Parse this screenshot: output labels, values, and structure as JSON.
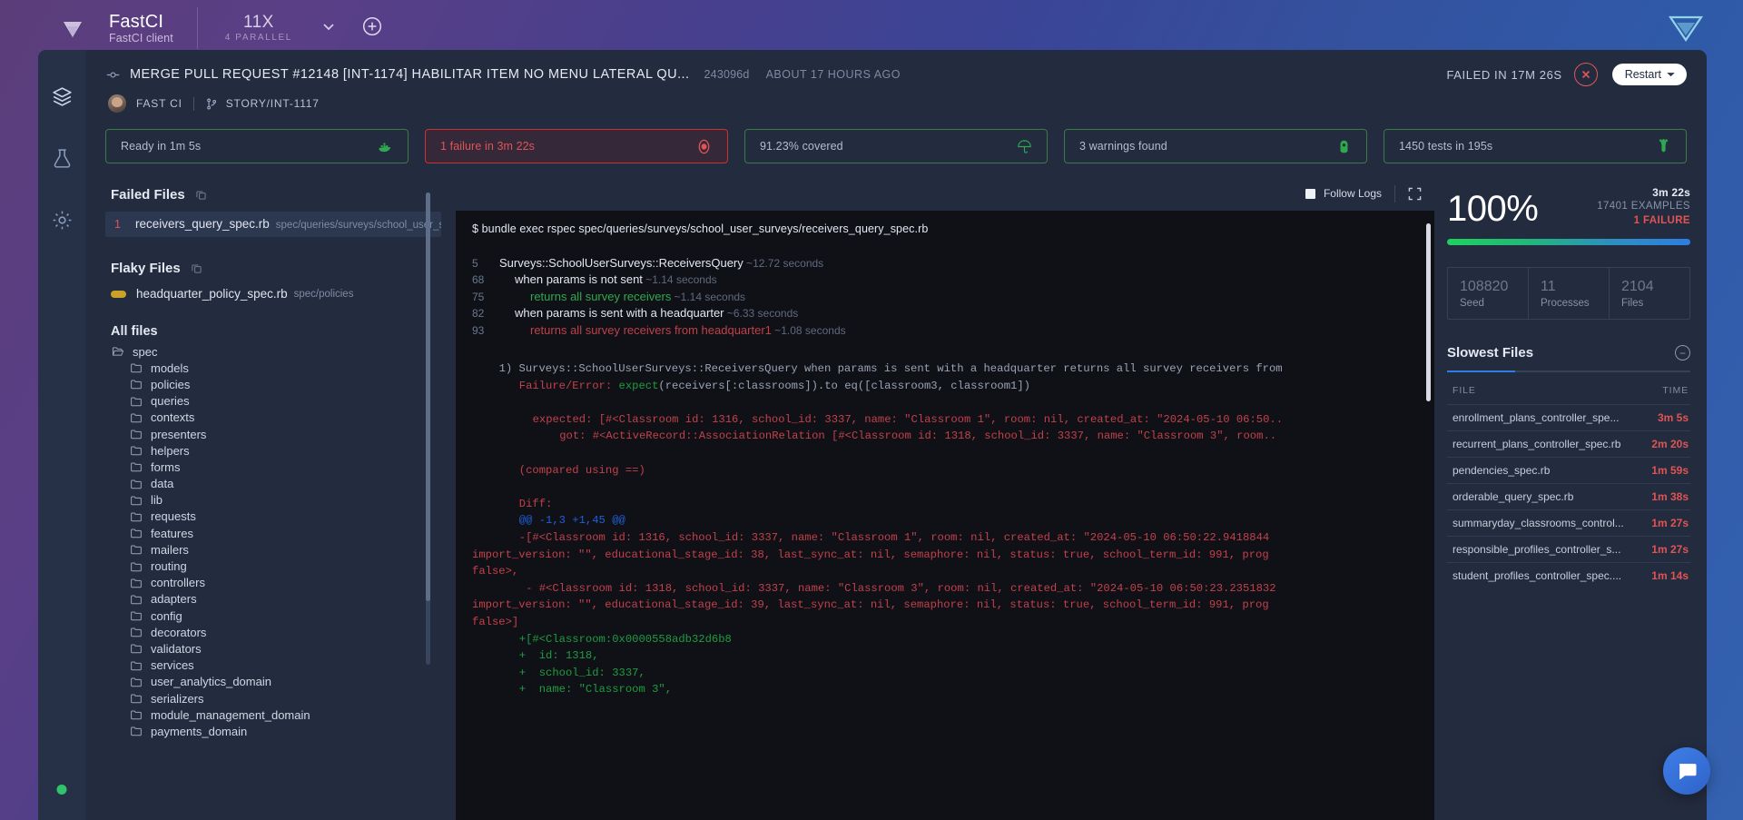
{
  "topbar": {
    "logo_icon": "fastci-diamond-logo",
    "brand_name": "FastCI",
    "brand_sub": "FastCI client",
    "parallel_value": "11X",
    "parallel_label": "4 PARALLEL",
    "chevron_icon": "chevron-down-icon",
    "add_icon": "plus-circle-icon",
    "right_logo_icon": "fastci-mark-icon"
  },
  "rail": {
    "items": [
      {
        "icon": "layers-icon",
        "name": "layers"
      },
      {
        "icon": "flask-icon",
        "name": "tests"
      },
      {
        "icon": "gear-icon",
        "name": "settings"
      }
    ],
    "status_dot_color": "#31c36a"
  },
  "head": {
    "pr_icon": "git-commit-icon",
    "title": "MERGE PULL REQUEST #12148 [INT-1174] HABILITAR ITEM NO MENU LATERAL QU...",
    "sha": "243096d",
    "time_ago": "ABOUT 17 HOURS AGO",
    "failed_in": "FAILED IN 17m 26s",
    "close_icon": "x-circle-icon",
    "restart_label": "Restart",
    "avatar_name": "user-avatar",
    "org": "FAST CI",
    "branch_icon": "git-branch-icon",
    "branch": "STORY/INT-1117"
  },
  "badges": [
    {
      "label": "Ready in 1m 5s",
      "icon": "docker-whale-icon",
      "state": "ok"
    },
    {
      "label": "1 failure in 3m 22s",
      "icon": "rspec-icon",
      "state": "fail"
    },
    {
      "label": "91.23% covered",
      "icon": "umbrella-icon",
      "state": "ok"
    },
    {
      "label": "3 warnings found",
      "icon": "rubocop-icon",
      "state": "ok"
    },
    {
      "label": "1450 tests in 195s",
      "icon": "jest-icon",
      "state": "ok"
    }
  ],
  "files": {
    "failed_title": "Failed Files",
    "copy_icon": "copy-icon",
    "failed_items": [
      {
        "count": "1",
        "name": "receivers_query_spec.rb",
        "path": "spec/queries/surveys/school_user_survey"
      }
    ],
    "flaky_title": "Flaky Files",
    "flaky_items": [
      {
        "name": "headquarter_policy_spec.rb",
        "path": "spec/policies"
      }
    ],
    "all_title": "All files",
    "root": {
      "icon": "folder-open-icon",
      "label": "spec"
    },
    "tree": [
      "models",
      "policies",
      "queries",
      "contexts",
      "presenters",
      "helpers",
      "forms",
      "data",
      "lib",
      "requests",
      "features",
      "mailers",
      "routing",
      "controllers",
      "adapters",
      "config",
      "decorators",
      "validators",
      "services",
      "user_analytics_domain",
      "serializers",
      "module_management_domain",
      "payments_domain"
    ],
    "folder_icon": "folder-icon"
  },
  "terminal": {
    "follow_label": "Follow Logs",
    "checkbox_icon": "checkbox-checked-icon",
    "expand_icon": "fullscreen-icon",
    "command": "$ bundle exec rspec spec/queries/surveys/school_user_surveys/receivers_query_spec.rb",
    "spec_rows": [
      {
        "num": "5",
        "indent": 0,
        "text": "Surveys::SchoolUserSurveys::ReceiversQuery",
        "dur": "~12.72 seconds",
        "color": "white"
      },
      {
        "num": "68",
        "indent": 1,
        "text": "when params is not sent",
        "dur": "~1.14 seconds",
        "color": "white"
      },
      {
        "num": "75",
        "indent": 2,
        "text": "returns all survey receivers",
        "dur": "~1.14 seconds",
        "color": "green"
      },
      {
        "num": "82",
        "indent": 1,
        "text": "when params is sent with a headquarter",
        "dur": "~6.33 seconds",
        "color": "white"
      },
      {
        "num": "93",
        "indent": 2,
        "text": "returns all survey receivers from headquarter1",
        "dur": "~1.08 seconds",
        "color": "red"
      }
    ],
    "failure_lines": [
      {
        "indent": 4,
        "segments": [
          {
            "t": "1) Surveys::SchoolUserSurveys::ReceiversQuery when params is sent with a headquarter returns all survey receivers from",
            "c": "dim"
          }
        ]
      },
      {
        "indent": 7,
        "segments": [
          {
            "t": "Failure/Error: ",
            "c": "red"
          },
          {
            "t": "expect",
            "c": "green"
          },
          {
            "t": "(receivers[:classrooms]).to eq([classroom3, classroom1])",
            "c": "dim"
          }
        ]
      },
      {
        "indent": 0,
        "segments": [
          {
            "t": "",
            "c": "dim"
          }
        ]
      },
      {
        "indent": 9,
        "segments": [
          {
            "t": "expected: [#<Classroom id: 1316, school_id: 3337, name: \"Classroom 1\", room: nil, created_at: \"2024-05-10 06:50..",
            "c": "red"
          }
        ]
      },
      {
        "indent": 13,
        "segments": [
          {
            "t": "got: #<ActiveRecord::AssociationRelation [#<Classroom id: 1318, school_id: 3337, name: \"Classroom 3\", room..",
            "c": "red"
          }
        ]
      },
      {
        "indent": 0,
        "segments": [
          {
            "t": "",
            "c": "dim"
          }
        ]
      },
      {
        "indent": 7,
        "segments": [
          {
            "t": "(compared using ==)",
            "c": "red"
          }
        ]
      },
      {
        "indent": 0,
        "segments": [
          {
            "t": "",
            "c": "dim"
          }
        ]
      },
      {
        "indent": 7,
        "segments": [
          {
            "t": "Diff:",
            "c": "red"
          }
        ]
      },
      {
        "indent": 7,
        "segments": [
          {
            "t": "@@ -1,3 +1,45 @@",
            "c": "blue"
          }
        ]
      },
      {
        "indent": 7,
        "segments": [
          {
            "t": "-[#<Classroom id: 1316, school_id: 3337, name: \"Classroom 1\", room: nil, created_at: \"2024-05-10 06:50:22.9418844",
            "c": "red"
          }
        ]
      },
      {
        "indent": 0,
        "segments": [
          {
            "t": "import_version: \"\", educational_stage_id: 38, last_sync_at: nil, semaphore: nil, status: true, school_term_id: 991, prog",
            "c": "red"
          }
        ]
      },
      {
        "indent": 0,
        "segments": [
          {
            "t": "false>,",
            "c": "red"
          }
        ]
      },
      {
        "indent": 7,
        "segments": [
          {
            "t": " - #<Classroom id: 1318, school_id: 3337, name: \"Classroom 3\", room: nil, created_at: \"2024-05-10 06:50:23.2351832",
            "c": "red"
          }
        ]
      },
      {
        "indent": 0,
        "segments": [
          {
            "t": "import_version: \"\", educational_stage_id: 39, last_sync_at: nil, semaphore: nil, status: true, school_term_id: 991, prog",
            "c": "red"
          }
        ]
      },
      {
        "indent": 0,
        "segments": [
          {
            "t": "false>]",
            "c": "red"
          }
        ]
      },
      {
        "indent": 7,
        "segments": [
          {
            "t": "+[#<Classroom:0x0000558adb32d6b8",
            "c": "green"
          }
        ]
      },
      {
        "indent": 7,
        "segments": [
          {
            "t": "+  id: 1318,",
            "c": "green"
          }
        ]
      },
      {
        "indent": 7,
        "segments": [
          {
            "t": "+  school_id: 3337,",
            "c": "green"
          }
        ]
      },
      {
        "indent": 7,
        "segments": [
          {
            "t": "+  name: \"Classroom 3\",",
            "c": "green"
          }
        ]
      }
    ]
  },
  "summary": {
    "percent": "100%",
    "duration": "3m 22s",
    "examples": "17401 EXAMPLES",
    "failures": "1 FAILURE",
    "stats": [
      {
        "value": "108820",
        "label": "Seed"
      },
      {
        "value": "11",
        "label": "Processes"
      },
      {
        "value": "2104",
        "label": "Files"
      }
    ],
    "slowest_title": "Slowest Files",
    "collapse_icon": "minus-circle-icon",
    "table_headers": {
      "file": "FILE",
      "time": "TIME"
    },
    "slowest_rows": [
      {
        "file": "enrollment_plans_controller_spe...",
        "time": "3m 5s"
      },
      {
        "file": "recurrent_plans_controller_spec.rb",
        "time": "2m 20s"
      },
      {
        "file": "pendencies_spec.rb",
        "time": "1m 59s"
      },
      {
        "file": "orderable_query_spec.rb",
        "time": "1m 38s"
      },
      {
        "file": "summaryday_classrooms_control...",
        "time": "1m 27s"
      },
      {
        "file": "responsible_profiles_controller_s...",
        "time": "1m 27s"
      },
      {
        "file": "student_profiles_controller_spec....",
        "time": "1m 14s"
      }
    ]
  },
  "chat": {
    "icon": "chat-bubble-icon"
  }
}
